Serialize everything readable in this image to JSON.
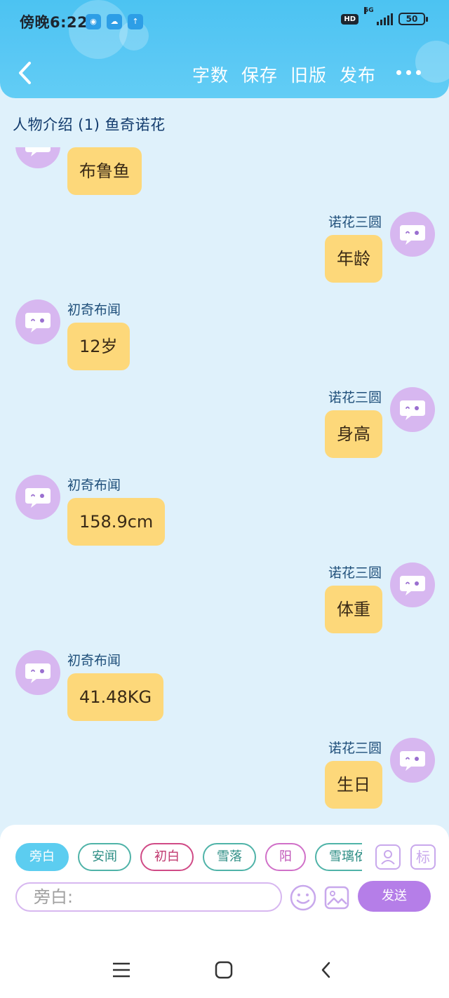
{
  "status_bar": {
    "time": "傍晚6:22",
    "hd": "HD",
    "network": "5G",
    "battery": "50",
    "icons": [
      "wifi-calling-icon",
      "cloud-icon",
      "upload-icon"
    ]
  },
  "header": {
    "actions": [
      "字数",
      "保存",
      "旧版",
      "发布"
    ],
    "back_icon": "chevron-left-icon",
    "more_icon": "more-dots-icon"
  },
  "chat_title": "人物介绍 (1) 鱼奇诺花",
  "messages": [
    {
      "side": "left",
      "sender": "",
      "text": "布鲁鱼"
    },
    {
      "side": "right",
      "sender": "诺花三圆",
      "text": "年龄"
    },
    {
      "side": "left",
      "sender": "初奇布闻",
      "text": "12岁"
    },
    {
      "side": "right",
      "sender": "诺花三圆",
      "text": "身高"
    },
    {
      "side": "left",
      "sender": "初奇布闻",
      "text": "158.9cm"
    },
    {
      "side": "right",
      "sender": "诺花三圆",
      "text": "体重"
    },
    {
      "side": "left",
      "sender": "初奇布闻",
      "text": "41.48KG"
    },
    {
      "side": "right",
      "sender": "诺花三圆",
      "text": "生日"
    }
  ],
  "roles": [
    {
      "label": "旁白",
      "active": true,
      "color": "#5ccdf0"
    },
    {
      "label": "安闻",
      "active": false,
      "color": "#4fb3a8"
    },
    {
      "label": "初白",
      "active": false,
      "color": "#d04a86"
    },
    {
      "label": "雪落",
      "active": false,
      "color": "#4fb3a8"
    },
    {
      "label": "阳",
      "active": false,
      "color": "#d070c8"
    },
    {
      "label": "雪璃依",
      "active": false,
      "color": "#4fb3a8"
    }
  ],
  "input": {
    "placeholder": "旁白:",
    "send_label": "发送",
    "tag_label": "标"
  },
  "colors": {
    "header": "#55c6f3",
    "background": "#dff1fb",
    "bubble": "#fdd87a",
    "avatar": "#d7b7f0",
    "send": "#b57ee8"
  }
}
